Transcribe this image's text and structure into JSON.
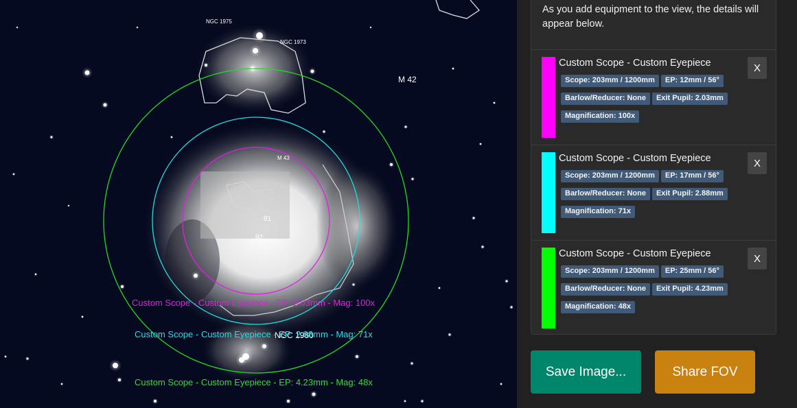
{
  "sky_labels": {
    "ngc1975": "NGC 1975",
    "ngc1973": "NGC 1973",
    "m42": "M 42",
    "m43": "M 43",
    "theta1": "θ1",
    "theta2": "θ2",
    "ngc1980": "NGC 1980"
  },
  "fov_captions": [
    {
      "text": "Custom Scope - Custom Eyepiece - EP: 2.03mm - Mag: 100x",
      "color": "#e020e0"
    },
    {
      "text": "Custom Scope - Custom Eyepiece - EP: 2.88mm - Mag: 71x",
      "color": "#20e0e8"
    },
    {
      "text": "Custom Scope - Custom Eyepiece - EP: 4.23mm - Mag: 48x",
      "color": "#30e030"
    }
  ],
  "panel": {
    "intro": "As you add equipment to the view, the details will appear below."
  },
  "equipment": [
    {
      "title": "Custom Scope - Custom Eyepiece",
      "color": "#ff00ff",
      "scope": "Scope: 203mm / 1200mm",
      "eyepiece": "EP: 12mm / 56°",
      "barlow": "Barlow/Reducer: None",
      "exit_pupil": "Exit Pupil: 2.03mm",
      "magnification": "Magnification: 100x",
      "remove_label": "X"
    },
    {
      "title": "Custom Scope - Custom Eyepiece",
      "color": "#00ffff",
      "scope": "Scope: 203mm / 1200mm",
      "eyepiece": "EP: 17mm / 56°",
      "barlow": "Barlow/Reducer: None",
      "exit_pupil": "Exit Pupil: 2.88mm",
      "magnification": "Magnification: 71x",
      "remove_label": "X"
    },
    {
      "title": "Custom Scope - Custom Eyepiece",
      "color": "#00ff00",
      "scope": "Scope: 203mm / 1200mm",
      "eyepiece": "EP: 25mm / 56°",
      "barlow": "Barlow/Reducer: None",
      "exit_pupil": "Exit Pupil: 4.23mm",
      "magnification": "Magnification: 48x",
      "remove_label": "X"
    }
  ],
  "buttons": {
    "save_label": "Save Image...",
    "save_color": "#00866a",
    "share_label": "Share FOV",
    "share_color": "#c98110"
  }
}
